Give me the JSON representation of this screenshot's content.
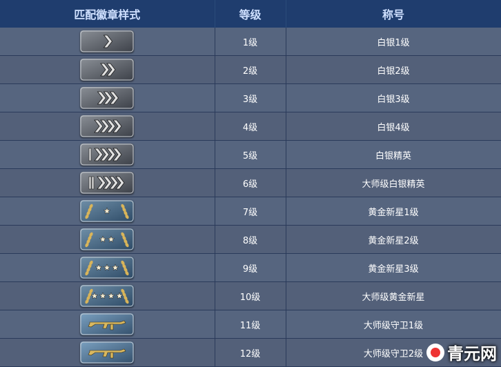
{
  "headers": [
    "匹配徽章样式",
    "等级",
    "称号"
  ],
  "rows": [
    {
      "level": "1级",
      "title": "白银1级",
      "badge": {
        "kind": "chevron",
        "count": 1,
        "bar": 0
      }
    },
    {
      "level": "2级",
      "title": "白银2级",
      "badge": {
        "kind": "chevron",
        "count": 2,
        "bar": 0
      }
    },
    {
      "level": "3级",
      "title": "白银3级",
      "badge": {
        "kind": "chevron",
        "count": 3,
        "bar": 0
      }
    },
    {
      "level": "4级",
      "title": "白银4级",
      "badge": {
        "kind": "chevron",
        "count": 4,
        "bar": 0
      }
    },
    {
      "level": "5级",
      "title": "白银精英",
      "badge": {
        "kind": "chevron",
        "count": 4,
        "bar": 1
      }
    },
    {
      "level": "6级",
      "title": "大师级白银精英",
      "badge": {
        "kind": "chevron",
        "count": 4,
        "bar": 2
      }
    },
    {
      "level": "7级",
      "title": "黄金新星1级",
      "badge": {
        "kind": "star",
        "count": 1
      }
    },
    {
      "level": "8级",
      "title": "黄金新星2级",
      "badge": {
        "kind": "star",
        "count": 2
      }
    },
    {
      "level": "9级",
      "title": "黄金新星3级",
      "badge": {
        "kind": "star",
        "count": 3
      }
    },
    {
      "level": "10级",
      "title": "大师级黄金新星",
      "badge": {
        "kind": "star",
        "count": 4
      }
    },
    {
      "level": "11级",
      "title": "大师级守卫1级",
      "badge": {
        "kind": "rifle"
      }
    },
    {
      "level": "12级",
      "title": "大师级守卫2级",
      "badge": {
        "kind": "rifle"
      }
    }
  ],
  "watermark": "青元网"
}
